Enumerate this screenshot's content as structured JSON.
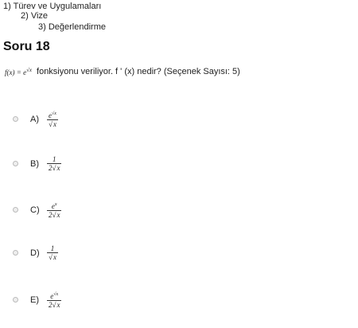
{
  "breadcrumb": {
    "level1": "1) Türev ve Uygulamaları",
    "level2": "2) Vize",
    "level3": "3) Değerlendirme"
  },
  "question": {
    "title": "Soru 18",
    "function_lhs": "f(x) = e",
    "function_exp": "√x",
    "text": "fonksiyonu veriliyor. f ' (x)  nedir?  (Seçenek Sayısı: 5)"
  },
  "options": [
    {
      "letter": "A)",
      "num_base": "e",
      "num_exp": "√x",
      "den_prefix": "",
      "den_sqrt": "x"
    },
    {
      "letter": "B)",
      "num_base": "1",
      "num_exp": "",
      "den_prefix": "2",
      "den_sqrt": "x"
    },
    {
      "letter": "C)",
      "num_base": "e",
      "num_exp": "x",
      "den_prefix": "2",
      "den_sqrt": "x"
    },
    {
      "letter": "D)",
      "num_base": "1",
      "num_exp": "",
      "den_prefix": "",
      "den_sqrt": "x"
    },
    {
      "letter": "E)",
      "num_base": "e",
      "num_exp": "√x",
      "den_prefix": "2",
      "den_sqrt": "x"
    }
  ]
}
